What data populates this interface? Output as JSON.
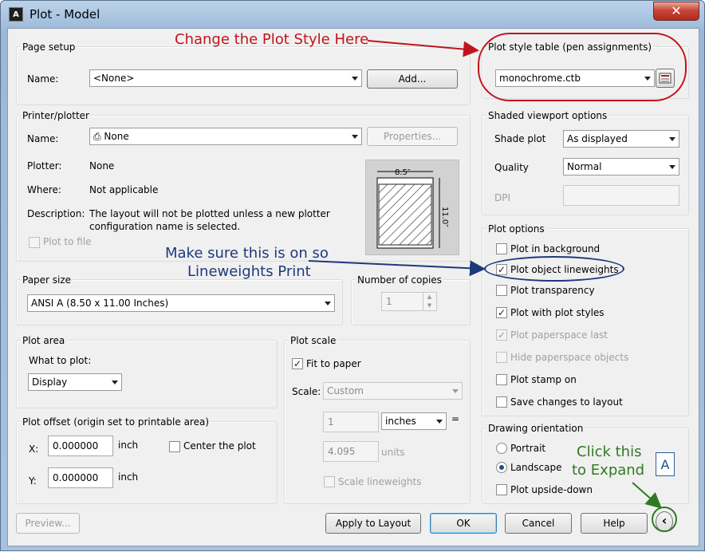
{
  "window": {
    "title": "Plot - Model",
    "app_icon": "A",
    "close": "✕"
  },
  "page_setup": {
    "group": "Page setup",
    "name_label": "Name:",
    "name_value": "<None>",
    "add_button": "Add..."
  },
  "printer": {
    "group": "Printer/plotter",
    "name_label": "Name:",
    "name_value": "None",
    "properties_button": "Properties...",
    "plotter_label": "Plotter:",
    "plotter_value": "None",
    "where_label": "Where:",
    "where_value": "Not applicable",
    "description_label": "Description:",
    "description_line1": "The layout will not be plotted unless a new plotter",
    "description_line2": "configuration name is selected.",
    "plot_to_file": "Plot to file",
    "preview_width": "8.5″",
    "preview_height": "11.0″"
  },
  "paper_size": {
    "group": "Paper size",
    "value": "ANSI A (8.50 x 11.00 Inches)"
  },
  "copies": {
    "group": "Number of copies",
    "value": "1"
  },
  "plot_area": {
    "group": "Plot area",
    "what_label": "What to plot:",
    "what_value": "Display"
  },
  "plot_offset": {
    "group": "Plot offset (origin set to printable area)",
    "x_label": "X:",
    "x_value": "0.000000",
    "x_unit": "inch",
    "y_label": "Y:",
    "y_value": "0.000000",
    "y_unit": "inch",
    "center": "Center the plot"
  },
  "plot_scale": {
    "group": "Plot scale",
    "fit": "Fit to paper",
    "scale_label": "Scale:",
    "scale_value": "Custom",
    "num": "1",
    "unit1": "inches",
    "equals": "=",
    "den": "4.095",
    "unit2": "units",
    "lineweights": "Scale lineweights"
  },
  "style_table": {
    "group": "Plot style table (pen assignments)",
    "value": "monochrome.ctb"
  },
  "shaded": {
    "group": "Shaded viewport options",
    "shade_label": "Shade plot",
    "shade_value": "As displayed",
    "quality_label": "Quality",
    "quality_value": "Normal",
    "dpi_label": "DPI"
  },
  "plot_options": {
    "group": "Plot options",
    "items": [
      {
        "label": "Plot in background",
        "checked": ""
      },
      {
        "label": "Plot object lineweights",
        "checked": "✓"
      },
      {
        "label": "Plot transparency",
        "checked": ""
      },
      {
        "label": "Plot with plot styles",
        "checked": "✓"
      },
      {
        "label": "Plot paperspace last",
        "checked": "✓"
      },
      {
        "label": "Hide paperspace objects",
        "checked": ""
      },
      {
        "label": "Plot stamp on",
        "checked": ""
      },
      {
        "label": "Save changes to layout",
        "checked": ""
      }
    ]
  },
  "orientation": {
    "group": "Drawing orientation",
    "portrait": "Portrait",
    "landscape": "Landscape",
    "upside": "Plot upside-down",
    "paper_icon": "A"
  },
  "footer": {
    "preview": "Preview...",
    "apply": "Apply to Layout",
    "ok": "OK",
    "cancel": "Cancel",
    "help": "Help",
    "expand": "‹"
  },
  "annotations": {
    "style": "Change the Plot Style Here",
    "lineweights_line1": "Make sure this is on so",
    "lineweights_line2": "Lineweights Print",
    "expand_line1": "Click this",
    "expand_line2": "to Expand"
  },
  "colors": {
    "annot_red": "#c0141c",
    "annot_blue": "#1c3a7a",
    "annot_green": "#2f7a20"
  }
}
